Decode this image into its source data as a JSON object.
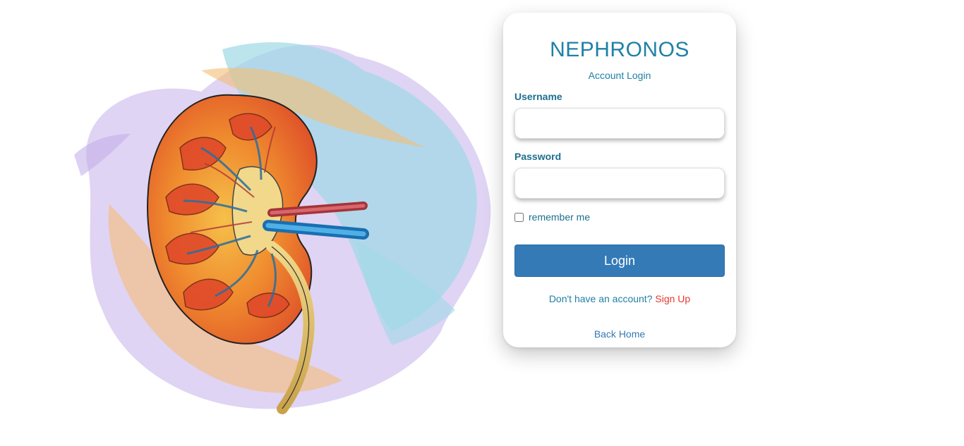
{
  "brand": {
    "title": "NEPHRONOS",
    "subtitle": "Account Login"
  },
  "form": {
    "username_label": "Username",
    "username_value": "",
    "password_label": "Password",
    "password_value": "",
    "remember_label": "remember me",
    "remember_checked": false,
    "login_label": "Login"
  },
  "footer": {
    "signup_prompt": "Don't have an account?",
    "signup_link": "Sign Up",
    "back_home": "Back Home"
  },
  "illustration": {
    "icon": "kidney-illustration"
  },
  "colors": {
    "brand": "#1f80a6",
    "primary_button": "#337ab7",
    "signup_link": "#e8382c"
  }
}
